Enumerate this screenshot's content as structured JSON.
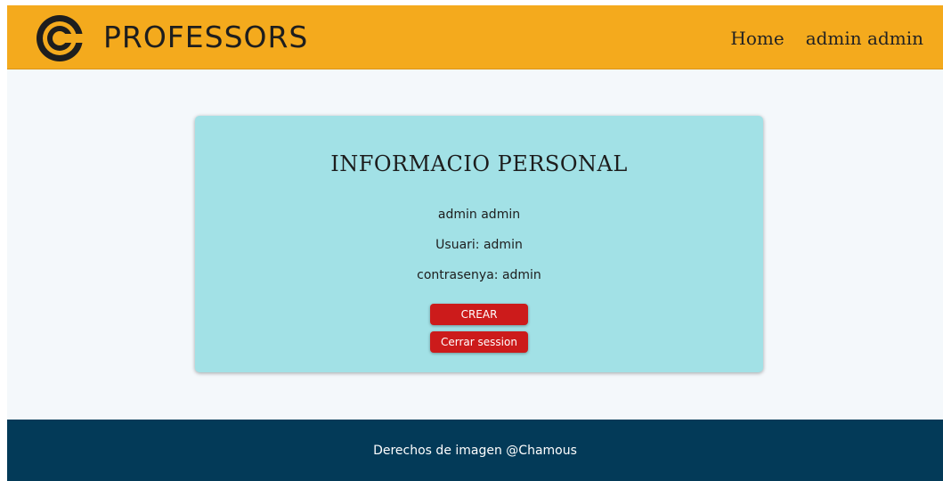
{
  "header": {
    "brand": "PROFESSORS",
    "logo_icon": "c-logo-icon",
    "nav": {
      "home": "Home",
      "user": "admin admin"
    }
  },
  "profile": {
    "title": "INFORMACIO PERSONAL",
    "full_name": "admin admin",
    "username_line": "Usuari: admin",
    "password_line": "contrasenya: admin",
    "create_button": "CREAR",
    "logout_button": "Cerrar session"
  },
  "footer": {
    "text": "Derechos de imagen @Chamous"
  },
  "colors": {
    "header_bg": "#f4aa1d",
    "card_bg": "#a2e1e6",
    "button_bg": "#cc1b1b",
    "footer_bg": "#033a58"
  }
}
